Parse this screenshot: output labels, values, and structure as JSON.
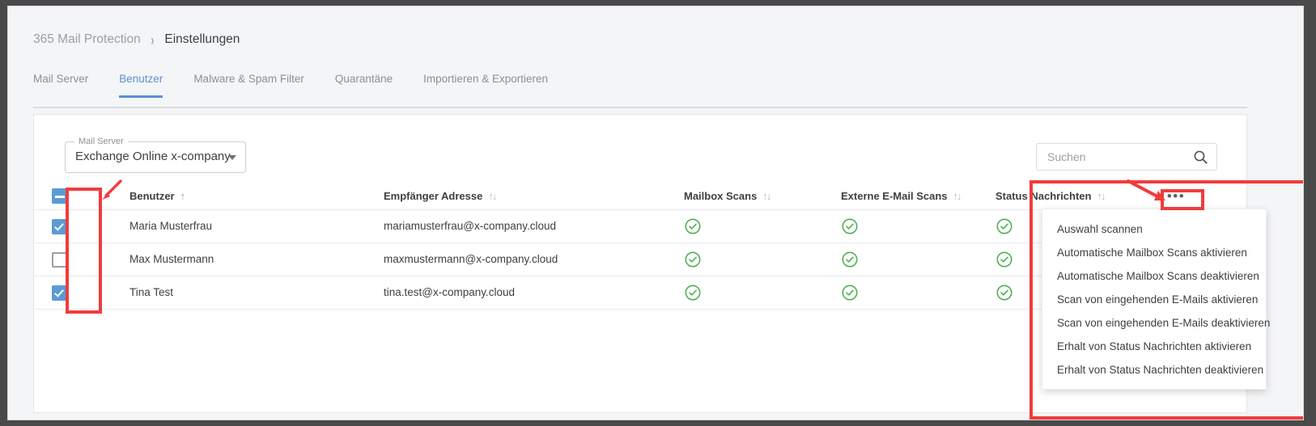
{
  "breadcrumb": {
    "root": "365 Mail Protection",
    "separator": "›",
    "current": "Einstellungen"
  },
  "tabs": [
    {
      "label": "Mail Server",
      "active": false
    },
    {
      "label": "Benutzer",
      "active": true
    },
    {
      "label": "Malware & Spam Filter",
      "active": false
    },
    {
      "label": "Quarantäne",
      "active": false
    },
    {
      "label": "Importieren & Exportieren",
      "active": false
    }
  ],
  "mail_server_select": {
    "legend": "Mail Server",
    "value": "Exchange Online x-company",
    "caret_icon": "chevron-down-icon"
  },
  "search": {
    "placeholder": "Suchen",
    "value": "",
    "icon": "search-icon"
  },
  "table": {
    "headers": {
      "select_all": "",
      "user": "Benutzer",
      "recipient_address": "Empfänger Adresse",
      "mailbox_scans": "Mailbox Scans",
      "external_email_scans": "Externe E-Mail Scans",
      "status_messages": "Status Nachrichten",
      "more": "•••"
    },
    "sort": {
      "user": "ascending",
      "recipient_address": "unsorted",
      "mailbox_scans": "unsorted",
      "external_email_scans": "unsorted",
      "status_messages": "unsorted"
    },
    "select_all_state": "indeterminate",
    "rows": [
      {
        "selected": true,
        "user": "Maria Musterfrau",
        "recipient_address": "mariamusterfrau@x-company.cloud",
        "mailbox_scans": "enabled",
        "external_email_scans": "enabled",
        "status_messages": "enabled"
      },
      {
        "selected": false,
        "user": "Max Mustermann",
        "recipient_address": "maxmustermann@x-company.cloud",
        "mailbox_scans": "enabled",
        "external_email_scans": "enabled",
        "status_messages": "enabled"
      },
      {
        "selected": true,
        "user": "Tina Test",
        "recipient_address": "tina.test@x-company.cloud",
        "mailbox_scans": "enabled",
        "external_email_scans": "enabled",
        "status_messages": "enabled"
      }
    ]
  },
  "context_menu": {
    "items": [
      "Auswahl scannen",
      "Automatische Mailbox Scans aktivieren",
      "Automatische Mailbox Scans deaktivieren",
      "Scan von eingehenden E-Mails aktivieren",
      "Scan von eingehenden E-Mails deaktivieren",
      "Erhalt von Status Nachrichten aktivieren",
      "Erhalt von Status Nachrichten deaktivieren"
    ]
  },
  "colors": {
    "accent": "#5c8fd6",
    "checkbox": "#5b9bd5",
    "status_ok": "#4caf50",
    "annotation": "#f03c3c"
  }
}
